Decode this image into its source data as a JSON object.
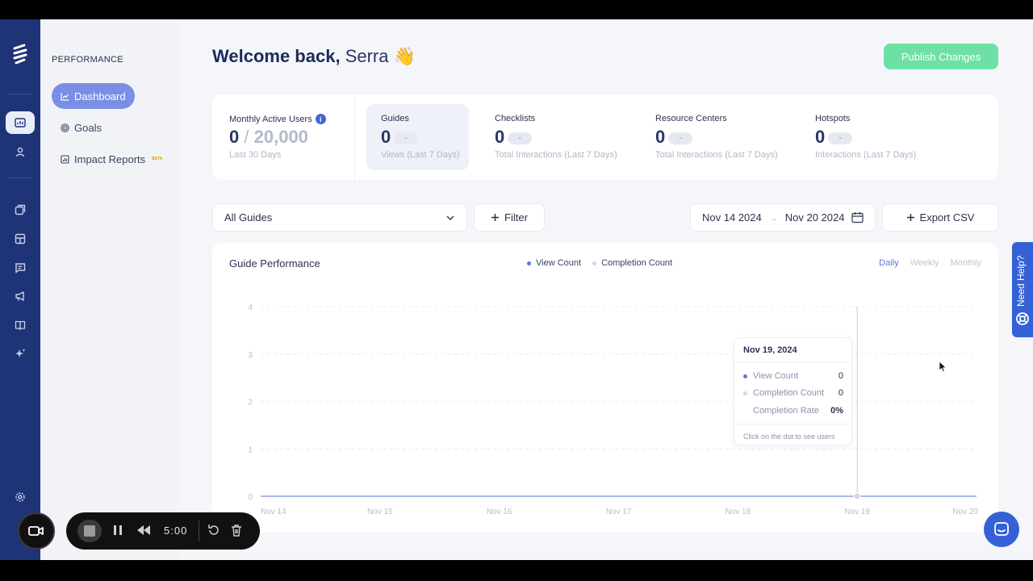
{
  "sidebar": {
    "section_title": "PERFORMANCE",
    "items": [
      {
        "label": "Dashboard",
        "icon": "chart-line-icon",
        "active": true
      },
      {
        "label": "Goals",
        "icon": "target-icon",
        "active": false
      },
      {
        "label": "Impact Reports",
        "icon": "report-icon",
        "active": false,
        "badge": "BETA"
      }
    ]
  },
  "rail": {
    "icons": [
      "logo-icon",
      "dashboard-icon",
      "user-icon",
      "guides-icon",
      "layout-icon",
      "chat-icon",
      "megaphone-icon",
      "book-icon",
      "sparkle-icon",
      "settings-icon",
      "logout-icon"
    ]
  },
  "header": {
    "welcome": "Welcome back,",
    "name": "Serra",
    "emoji": "👋",
    "publish_label": "Publish Changes"
  },
  "stats": {
    "mau": {
      "label": "Monthly Active Users",
      "value": "0",
      "max": "20,000",
      "sub": "Last 30 Days"
    },
    "cards": [
      {
        "label": "Guides",
        "value": "0",
        "change": "-",
        "sub": "Views (Last 7 Days)"
      },
      {
        "label": "Checklists",
        "value": "0",
        "change": "-",
        "sub": "Total Interactions (Last 7 Days)"
      },
      {
        "label": "Resource Centers",
        "value": "0",
        "change": "-",
        "sub": "Total Interactions (Last 7 Days)"
      },
      {
        "label": "Hotspots",
        "value": "0",
        "change": "-",
        "sub": "Interactions (Last 7 Days)"
      }
    ]
  },
  "controls": {
    "guide_select": "All Guides",
    "filter_label": "Filter",
    "date_start": "Nov 14 2024",
    "date_end": "Nov 20 2024",
    "export_label": "Export CSV"
  },
  "chart_panel": {
    "title": "Guide Performance",
    "legend": [
      "View Count",
      "Completion Count"
    ],
    "periods": [
      "Daily",
      "Weekly",
      "Monthly"
    ],
    "active_period": "Daily",
    "tooltip": {
      "date": "Nov 19, 2024",
      "rows": [
        {
          "label": "View Count",
          "value": "0"
        },
        {
          "label": "Completion Count",
          "value": "0"
        },
        {
          "label": "Completion Rate",
          "value": "0%"
        }
      ],
      "hint": "Click on the dot to see users"
    }
  },
  "chart_data": {
    "type": "line",
    "categories": [
      "Nov 14",
      "Nov 15",
      "Nov 16",
      "Nov 17",
      "Nov 18",
      "Nov 19",
      "Nov 20"
    ],
    "series": [
      {
        "name": "View Count",
        "values": [
          0,
          0,
          0,
          0,
          0,
          0,
          0
        ],
        "color": "#5c77d8"
      },
      {
        "name": "Completion Count",
        "values": [
          0,
          0,
          0,
          0,
          0,
          0,
          0
        ],
        "color": "#d3d8e4"
      }
    ],
    "yticks": [
      0,
      1,
      2,
      3,
      4
    ],
    "ylim": [
      0,
      4
    ],
    "highlighted_category": "Nov 19",
    "grid": true
  },
  "help": {
    "label": "Need Help?"
  },
  "recorder": {
    "time": "5:00"
  },
  "colors": {
    "rail": "#1f3377",
    "accent": "#5c77d8",
    "publish": "#6ee0a3",
    "help": "#3561d6"
  }
}
